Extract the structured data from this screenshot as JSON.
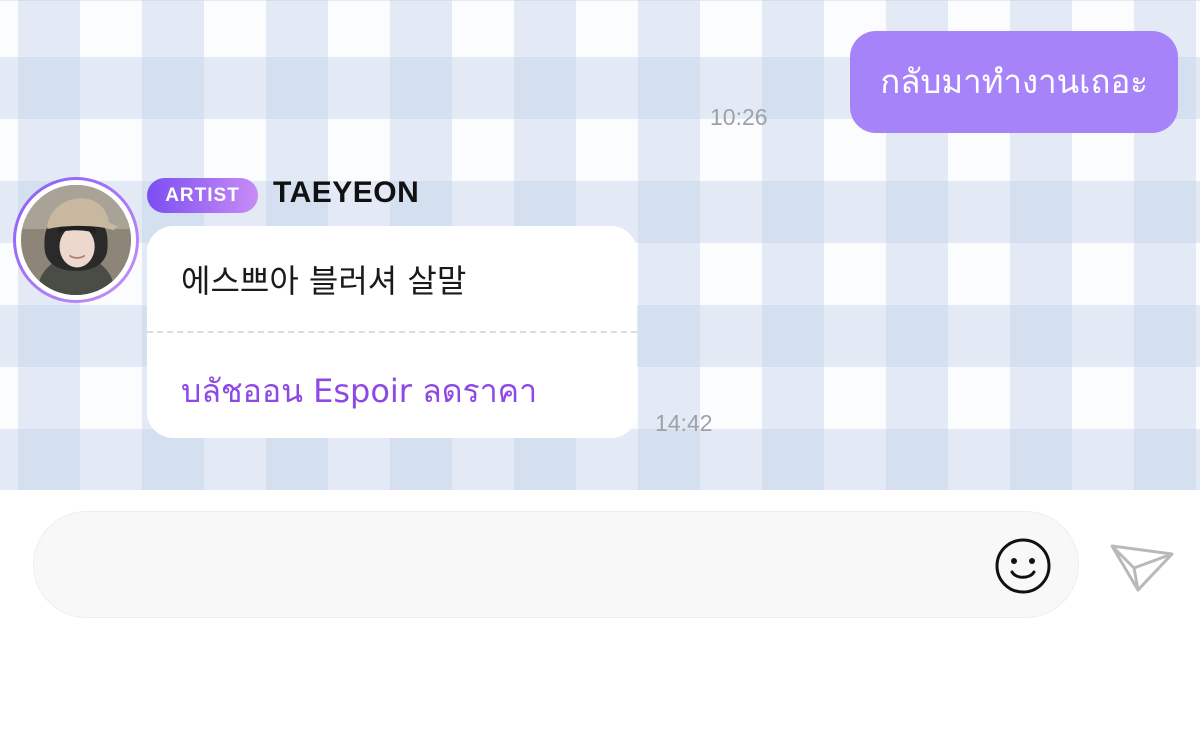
{
  "messages": {
    "outgoing": {
      "text": "กลับมาทำงานเถอะ",
      "time": "10:26"
    },
    "incoming": {
      "badge": "ARTIST",
      "sender": "TAEYEON",
      "text": "에스쁘아 블러셔 살말",
      "translation": "บลัชออน Espoir ลดราคา",
      "time": "14:42"
    }
  },
  "composer": {
    "input_value": "",
    "input_placeholder": "",
    "emoji_icon": "smiley-icon",
    "send_icon": "paper-plane-icon"
  },
  "colors": {
    "outgoing_bubble": "#a783f9",
    "translation_text": "#8e48e6",
    "badge_gradient_start": "#7b4ef2",
    "badge_gradient_end": "#c88cf5"
  }
}
